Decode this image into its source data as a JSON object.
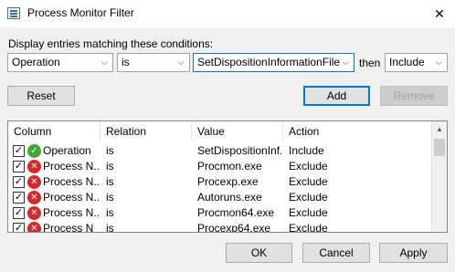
{
  "window": {
    "title": "Process Monitor Filter",
    "close_glyph": "✕"
  },
  "conditions": {
    "label": "Display entries matching these conditions:",
    "column_value": "Operation",
    "relation_value": "is",
    "value_value": "SetDispositionInformationFile",
    "then_label": "then",
    "action_value": "Include"
  },
  "buttons": {
    "reset": "Reset",
    "add": "Add",
    "remove": "Remove",
    "ok": "OK",
    "cancel": "Cancel",
    "apply": "Apply"
  },
  "list": {
    "headers": {
      "column": "Column",
      "relation": "Relation",
      "value": "Value",
      "action": "Action"
    },
    "rows": [
      {
        "column": "Operation",
        "relation": "is",
        "value": "SetDispositionInf...",
        "action": "Include",
        "checked": true,
        "status_icon": "include-icon"
      },
      {
        "column": "Process N...",
        "relation": "is",
        "value": "Procmon.exe",
        "action": "Exclude",
        "checked": true,
        "status_icon": "exclude-icon"
      },
      {
        "column": "Process N...",
        "relation": "is",
        "value": "Procexp.exe",
        "action": "Exclude",
        "checked": true,
        "status_icon": "exclude-icon"
      },
      {
        "column": "Process N...",
        "relation": "is",
        "value": "Autoruns.exe",
        "action": "Exclude",
        "checked": true,
        "status_icon": "exclude-icon"
      },
      {
        "column": "Process N...",
        "relation": "is",
        "value": "Procmon64.exe",
        "action": "Exclude",
        "checked": true,
        "status_icon": "exclude-icon"
      },
      {
        "column": "Process N",
        "relation": "is",
        "value": "Procexp64.exe",
        "action": "Exclude",
        "checked": true,
        "status_icon": "exclude-icon"
      }
    ]
  },
  "colors": {
    "accent": "#0078d7",
    "include": "#3aaa35",
    "exclude": "#d9262a"
  }
}
